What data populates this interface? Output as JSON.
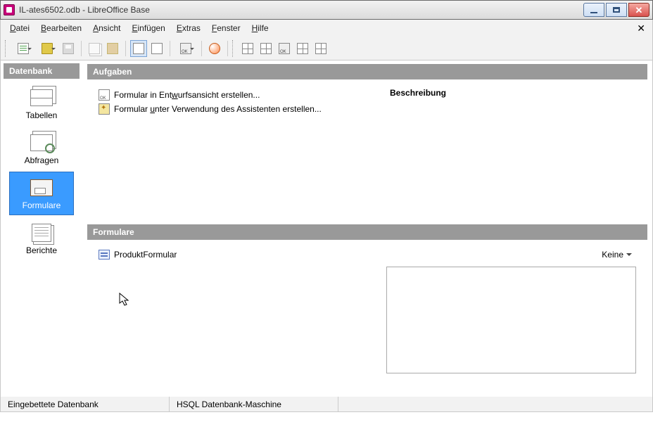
{
  "window": {
    "title": "IL-ates6502.odb - LibreOffice Base"
  },
  "menu": {
    "datei": "Datei",
    "bearbeiten": "Bearbeiten",
    "ansicht": "Ansicht",
    "einfuegen": "Einfügen",
    "extras": "Extras",
    "fenster": "Fenster",
    "hilfe": "Hilfe"
  },
  "sidebar": {
    "header": "Datenbank",
    "tabellen": "Tabellen",
    "abfragen": "Abfragen",
    "formulare": "Formulare",
    "berichte": "Berichte"
  },
  "tasks": {
    "header": "Aufgaben",
    "design_form": "Formular in Entwurfsansicht erstellen...",
    "wizard_form": "Formular unter Verwendung des Assistenten erstellen...",
    "description_label": "Beschreibung"
  },
  "forms": {
    "header": "Formulare",
    "item": "ProduktFormular",
    "view": "Keine"
  },
  "status": {
    "embedded": "Eingebettete Datenbank",
    "engine": "HSQL Datenbank-Maschine"
  }
}
